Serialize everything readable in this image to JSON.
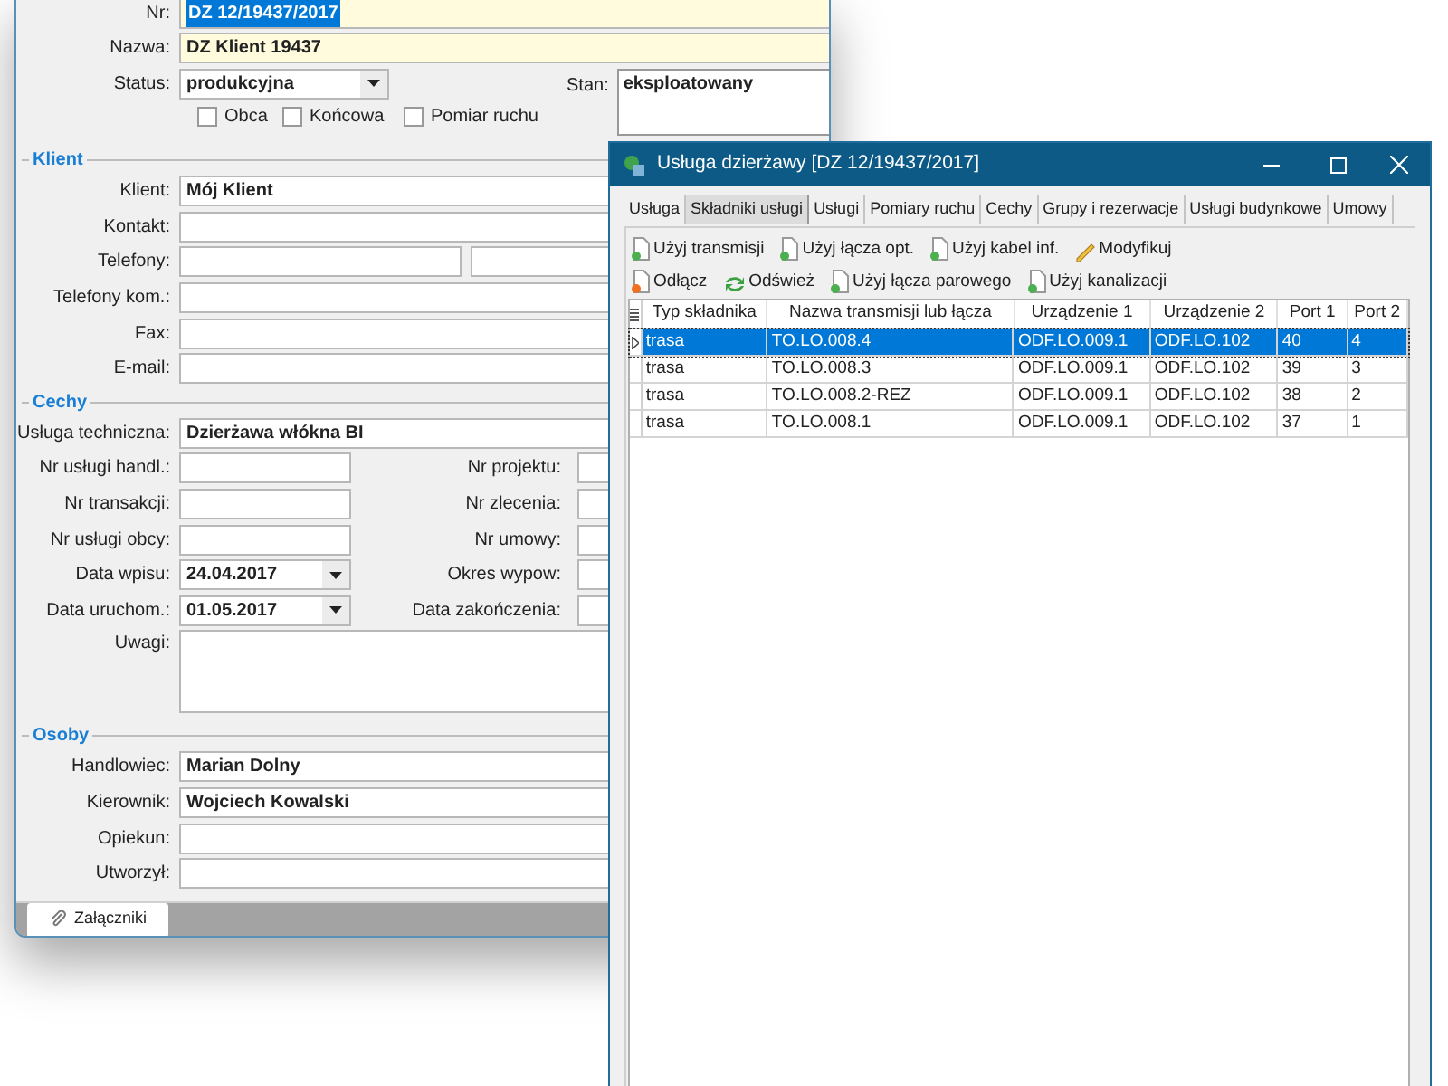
{
  "main_form": {
    "top_rows": [
      {
        "label": "Nr:",
        "value": "DZ 12/19437/2017",
        "required": true,
        "text_selected": true
      },
      {
        "label": "Nazwa:",
        "value": "DZ Klient 19437",
        "required": true,
        "text_selected": false
      }
    ],
    "status": {
      "label": "Status:",
      "value": "produkcyjna"
    },
    "checkboxes": [
      {
        "label": "Obca",
        "checked": false
      },
      {
        "label": "Końcowa",
        "checked": false
      },
      {
        "label": "Pomiar ruchu",
        "checked": false
      }
    ],
    "stan": {
      "label": "Stan:",
      "value": "eksploatowany"
    },
    "sections": [
      {
        "title": "Klient",
        "rows": [
          {
            "kind": "text",
            "label": "Klient:",
            "value": "Mój Klient"
          },
          {
            "kind": "text",
            "label": "Kontakt:"
          },
          {
            "kind": "pair",
            "label": "Telefony:"
          },
          {
            "kind": "text",
            "label": "Telefony kom.:"
          },
          {
            "kind": "text",
            "label": "Fax:"
          },
          {
            "kind": "text",
            "label": "E-mail:"
          }
        ]
      },
      {
        "title": "Cechy",
        "rows": [
          {
            "kind": "text",
            "label": "Usługa techniczna:",
            "value": "Dzierżawa włókna BI"
          },
          {
            "kind": "split",
            "label": "Nr usługi handl.:",
            "right_label": "Nr projektu:"
          },
          {
            "kind": "split",
            "label": "Nr transakcji:",
            "right_label": "Nr zlecenia:"
          },
          {
            "kind": "split",
            "label": "Nr usługi obcy:",
            "right_label": "Nr umowy:"
          },
          {
            "kind": "date",
            "label": "Data wpisu:",
            "value": "24.04.2017",
            "right_label": "Okres wypow:"
          },
          {
            "kind": "date",
            "label": "Data uruchom.:",
            "value": "01.05.2017",
            "right_label": "Data zakończenia:"
          },
          {
            "kind": "memo",
            "label": "Uwagi:"
          }
        ]
      },
      {
        "title": "Osoby",
        "rows": [
          {
            "kind": "text",
            "label": "Handlowiec:",
            "value": "Marian Dolny"
          },
          {
            "kind": "text",
            "label": "Kierownik:",
            "value": "Wojciech Kowalski"
          },
          {
            "kind": "text",
            "label": "Opiekun:"
          },
          {
            "kind": "text",
            "label": "Utworzył:"
          }
        ]
      }
    ],
    "footer_button": "Załączniki"
  },
  "dialog": {
    "title": "Usługa dzierżawy [DZ 12/19437/2017]",
    "tabs": [
      {
        "label": "Usługa",
        "selected": false
      },
      {
        "label": "Składniki usługi",
        "selected": true
      },
      {
        "label": "Usługi",
        "selected": false
      },
      {
        "label": "Pomiary ruchu",
        "selected": false
      },
      {
        "label": "Cechy",
        "selected": false
      },
      {
        "label": "Grupy i rezerwacje",
        "selected": false
      },
      {
        "label": "Usługi budynkowe",
        "selected": false
      },
      {
        "label": "Umowy",
        "selected": false
      }
    ],
    "toolbar_rows": [
      [
        {
          "kind": "add",
          "label": "Użyj transmisji"
        },
        {
          "kind": "add",
          "label": "Użyj łącza opt."
        },
        {
          "kind": "add",
          "label": "Użyj kabel inf."
        },
        {
          "kind": "edit",
          "label": "Modyfikuj"
        }
      ],
      [
        {
          "kind": "remove",
          "label": "Odłącz"
        },
        {
          "kind": "refresh",
          "label": "Odśwież"
        },
        {
          "kind": "add",
          "label": "Użyj łącza parowego"
        },
        {
          "kind": "add",
          "label": "Użyj kanalizacji"
        }
      ]
    ],
    "grid": {
      "columns": [
        "Typ składnika",
        "Nazwa transmisji lub łącza",
        "Urządzenie 1",
        "Urządzenie 2",
        "Port 1",
        "Port 2"
      ],
      "rows": [
        {
          "selected": true,
          "cells": [
            "trasa",
            "TO.LO.008.4",
            "ODF.LO.009.1",
            "ODF.LO.102",
            "40",
            "4"
          ]
        },
        {
          "selected": false,
          "cells": [
            "trasa",
            "TO.LO.008.3",
            "ODF.LO.009.1",
            "ODF.LO.102",
            "39",
            "3"
          ]
        },
        {
          "selected": false,
          "cells": [
            "trasa",
            "TO.LO.008.2-REZ",
            "ODF.LO.009.1",
            "ODF.LO.102",
            "38",
            "2"
          ]
        },
        {
          "selected": false,
          "cells": [
            "trasa",
            "TO.LO.008.1",
            "ODF.LO.009.1",
            "ODF.LO.102",
            "37",
            "1"
          ]
        }
      ]
    }
  }
}
